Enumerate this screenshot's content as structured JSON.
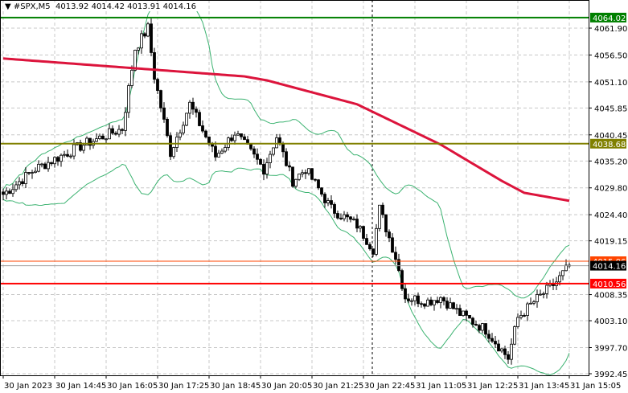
{
  "header": {
    "symbol": "#SPX,M5",
    "open": "4013.92",
    "high": "4014.42",
    "low": "4013.91",
    "close": "4014.16"
  },
  "chart_data": {
    "type": "candlestick",
    "symbol": "#SPX",
    "timeframe": "M5",
    "ylim": [
      3992.45,
      4064.5
    ],
    "y_ticks": [
      "4061.90",
      "4056.50",
      "4051.10",
      "4045.85",
      "4040.45",
      "4035.20",
      "4029.80",
      "4024.40",
      "4019.15",
      "4008.35",
      "4003.10",
      "3997.70",
      "3992.45"
    ],
    "x_ticks": [
      "30 Jan 2023",
      "30 Jan 14:45",
      "30 Jan 16:05",
      "30 Jan 17:25",
      "30 Jan 18:45",
      "30 Jan 20:05",
      "30 Jan 21:25",
      "30 Jan 22:45",
      "31 Jan 11:05",
      "31 Jan 12:25",
      "31 Jan 13:45",
      "31 Jan 15:05"
    ],
    "bars": 177,
    "price_path": [
      [
        0,
        4028.5
      ],
      [
        10,
        4033.6
      ],
      [
        25,
        4038.5
      ],
      [
        37,
        4041.7
      ],
      [
        41,
        4057.8
      ],
      [
        45,
        4061.9
      ],
      [
        47,
        4052.2
      ],
      [
        52,
        4036.9
      ],
      [
        58,
        4046.6
      ],
      [
        66,
        4036.1
      ],
      [
        72,
        4040.9
      ],
      [
        81,
        4033.6
      ],
      [
        85,
        4040.1
      ],
      [
        90,
        4031.2
      ],
      [
        94,
        4033.6
      ],
      [
        102,
        4025.6
      ],
      [
        110,
        4022.3
      ],
      [
        115,
        4017.5
      ],
      [
        117,
        4025.6
      ],
      [
        122,
        4015.9
      ],
      [
        125,
        4007.8
      ],
      [
        132,
        4007.0
      ],
      [
        136,
        4007.8
      ],
      [
        142,
        4004.5
      ],
      [
        150,
        4001.3
      ],
      [
        157,
        3995.6
      ],
      [
        160,
        4003.7
      ],
      [
        165,
        4006.9
      ],
      [
        172,
        4010.9
      ],
      [
        176,
        4014.16
      ]
    ],
    "ma_path": [
      [
        0,
        4055.8
      ],
      [
        75,
        4052.2
      ],
      [
        82,
        4051.4
      ],
      [
        110,
        4046.6
      ],
      [
        136,
        4038.5
      ],
      [
        155,
        4031.2
      ],
      [
        162,
        4028.8
      ],
      [
        176,
        4027.2
      ]
    ],
    "levels": [
      {
        "name": "resistance-high",
        "price": "4064.02",
        "color": "#008000"
      },
      {
        "name": "resistance-mid",
        "price": "4038.68",
        "color": "#808000"
      },
      {
        "name": "pending-level",
        "price": "4015.06",
        "color": "#ff4500"
      },
      {
        "name": "current-price",
        "price": "4014.16",
        "color": "#000000"
      },
      {
        "name": "support",
        "price": "4010.56",
        "color": "#ff0000"
      }
    ],
    "colors": {
      "ma": "#dc143c",
      "bands": "#3cb371",
      "candle": "#000000"
    }
  }
}
